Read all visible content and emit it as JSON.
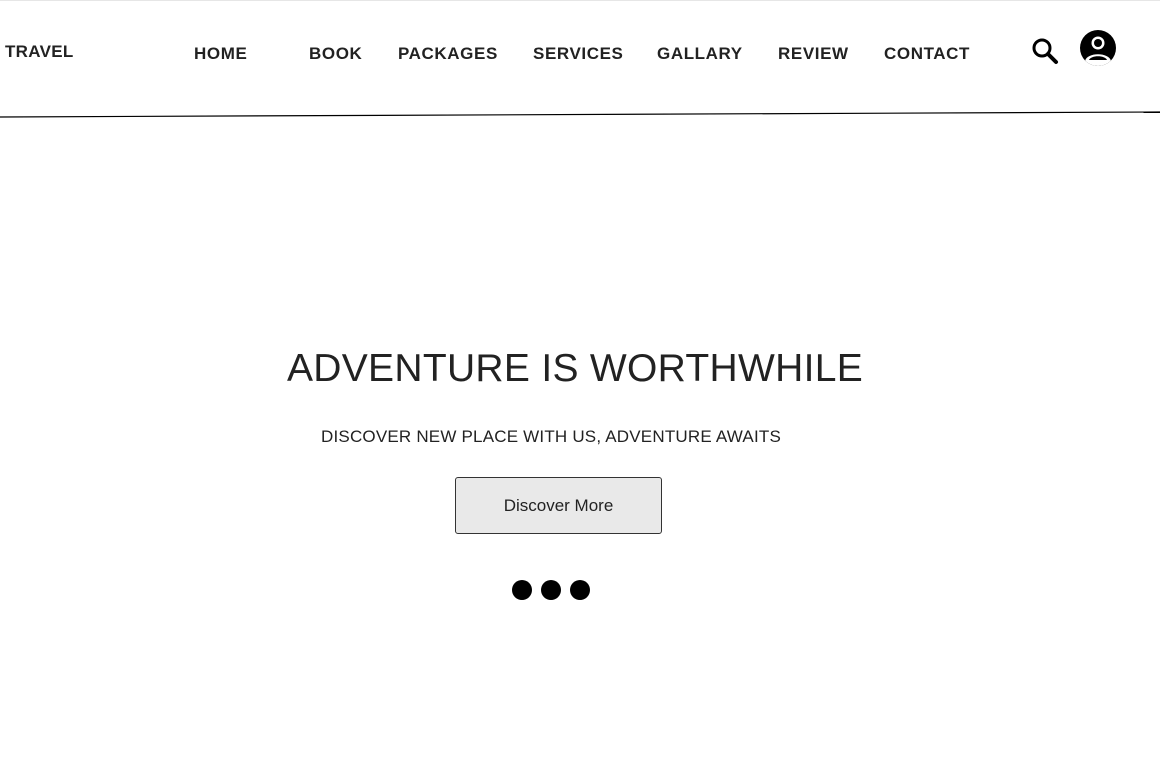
{
  "header": {
    "logo": "TRAVEL",
    "nav": {
      "home": "HOME",
      "book": "BOOK",
      "packages": "PACKAGES",
      "services": "SERVICES",
      "gallary": "GALLARY",
      "review": "REVIEW",
      "contact": "CONTACT"
    },
    "icons": {
      "search": "search-icon",
      "account": "account-circle-icon"
    }
  },
  "hero": {
    "title": "ADVENTURE IS WORTHWHILE",
    "subtitle": "DISCOVER NEW PLACE WITH US, ADVENTURE AWAITS",
    "button_label": "Discover More",
    "slide_count": 3
  },
  "colors": {
    "text": "#222222",
    "button_bg": "#e9e9e9",
    "dot": "#000000"
  }
}
